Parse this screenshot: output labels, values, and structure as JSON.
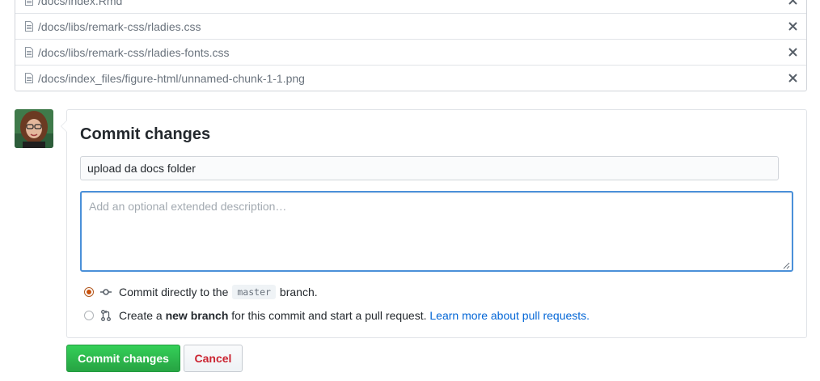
{
  "files": [
    {
      "path": "/docs/index.Rmd"
    },
    {
      "path": "/docs/libs/remark-css/rladies.css"
    },
    {
      "path": "/docs/libs/remark-css/rladies-fonts.css"
    },
    {
      "path": "/docs/index_files/figure-html/unnamed-chunk-1-1.png"
    }
  ],
  "commit": {
    "heading": "Commit changes",
    "summary_value": "upload da docs folder",
    "description_placeholder": "Add an optional extended description…",
    "option_direct": {
      "prefix": "Commit directly to the",
      "branch": "master",
      "suffix": "branch."
    },
    "option_new_branch": {
      "prefix": "Create a",
      "bold": "new branch",
      "suffix": "for this commit and start a pull request.",
      "link": "Learn more about pull requests."
    }
  },
  "buttons": {
    "commit_label": "Commit changes",
    "cancel_label": "Cancel"
  },
  "colors": {
    "primary_green": "#28a745",
    "cancel_red": "#cb2431",
    "link_blue": "#0366d6",
    "focus_blue": "#4a90d9",
    "radio_orange": "#c9510c"
  },
  "icons": {
    "file": "file-icon",
    "remove": "close-icon",
    "commit": "git-commit-icon",
    "pull_request": "git-pull-request-icon"
  }
}
